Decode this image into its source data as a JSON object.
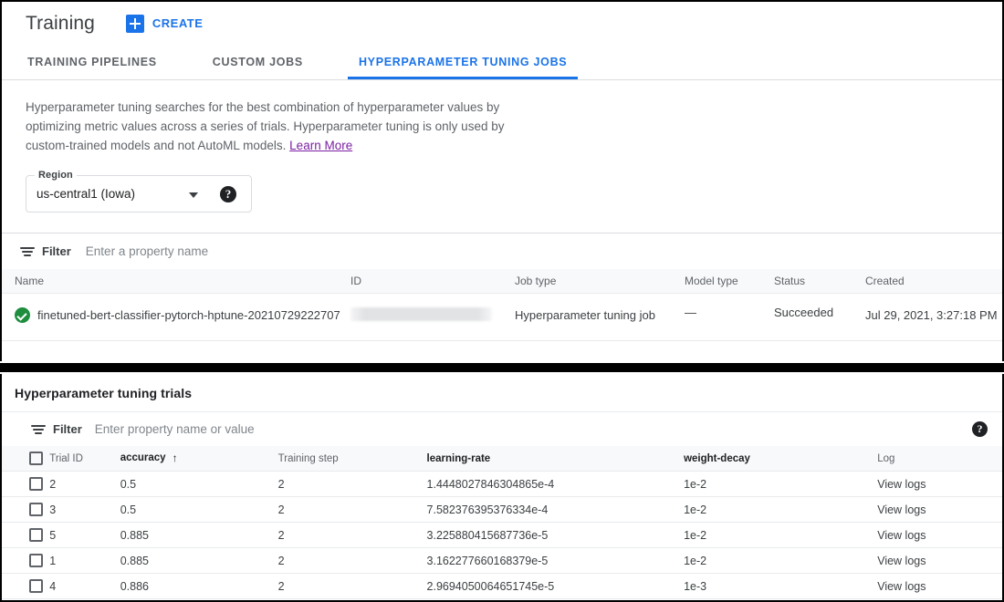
{
  "header": {
    "title": "Training",
    "create_label": "CREATE",
    "plus_icon": "plus-icon",
    "accent_color": "#1a73e8"
  },
  "tabs": [
    {
      "label": "TRAINING PIPELINES",
      "active": false
    },
    {
      "label": "CUSTOM JOBS",
      "active": false
    },
    {
      "label": "HYPERPARAMETER TUNING JOBS",
      "active": true
    }
  ],
  "description": {
    "text": "Hyperparameter tuning searches for the best combination of hyperparameter values by optimizing metric values across a series of trials. Hyperparameter tuning is only used by custom-trained models and not AutoML models.",
    "link_label": "Learn More",
    "link_color": "#7b1fa2"
  },
  "region": {
    "legend": "Region",
    "value": "us-central1 (Iowa)",
    "caret_icon": "chevron-down-icon",
    "help_icon": "help-icon",
    "help_glyph": "?"
  },
  "jobs_filter": {
    "icon": "filter-icon",
    "label": "Filter",
    "placeholder": "Enter a property name"
  },
  "jobs_table": {
    "columns": [
      "Name",
      "ID",
      "Job type",
      "Model type",
      "Status",
      "Created"
    ],
    "rows": [
      {
        "status_icon": "success-check-icon",
        "name": "finetuned-bert-classifier-pytorch-hptune-20210729222707",
        "id": "",
        "job_type": "Hyperparameter tuning job",
        "model_type": "—",
        "status": "Succeeded",
        "created": "Jul 29, 2021, 3:27:18 PM"
      }
    ]
  },
  "trials_panel": {
    "title": "Hyperparameter tuning trials",
    "filter": {
      "icon": "filter-icon",
      "label": "Filter",
      "placeholder": "Enter property name or value"
    },
    "help_icon": "help-icon",
    "help_glyph": "?",
    "columns": [
      {
        "label": "Trial ID",
        "strong": false
      },
      {
        "label": "accuracy",
        "strong": true,
        "sorted": true,
        "sort_arrow": "↑"
      },
      {
        "label": "Training step",
        "strong": false
      },
      {
        "label": "learning-rate",
        "strong": true
      },
      {
        "label": "weight-decay",
        "strong": true
      },
      {
        "label": "Log",
        "strong": false
      }
    ],
    "rows": [
      {
        "trial_id": "2",
        "accuracy": "0.5",
        "training_step": "2",
        "learning_rate": "1.4448027846304865e-4",
        "weight_decay": "1e-2",
        "log": "View logs"
      },
      {
        "trial_id": "3",
        "accuracy": "0.5",
        "training_step": "2",
        "learning_rate": "7.582376395376334e-4",
        "weight_decay": "1e-2",
        "log": "View logs"
      },
      {
        "trial_id": "5",
        "accuracy": "0.885",
        "training_step": "2",
        "learning_rate": "3.225880415687736e-5",
        "weight_decay": "1e-2",
        "log": "View logs"
      },
      {
        "trial_id": "1",
        "accuracy": "0.885",
        "training_step": "2",
        "learning_rate": "3.162277660168379e-5",
        "weight_decay": "1e-2",
        "log": "View logs"
      },
      {
        "trial_id": "4",
        "accuracy": "0.886",
        "training_step": "2",
        "learning_rate": "2.9694050064651745e-5",
        "weight_decay": "1e-3",
        "log": "View logs"
      }
    ]
  }
}
